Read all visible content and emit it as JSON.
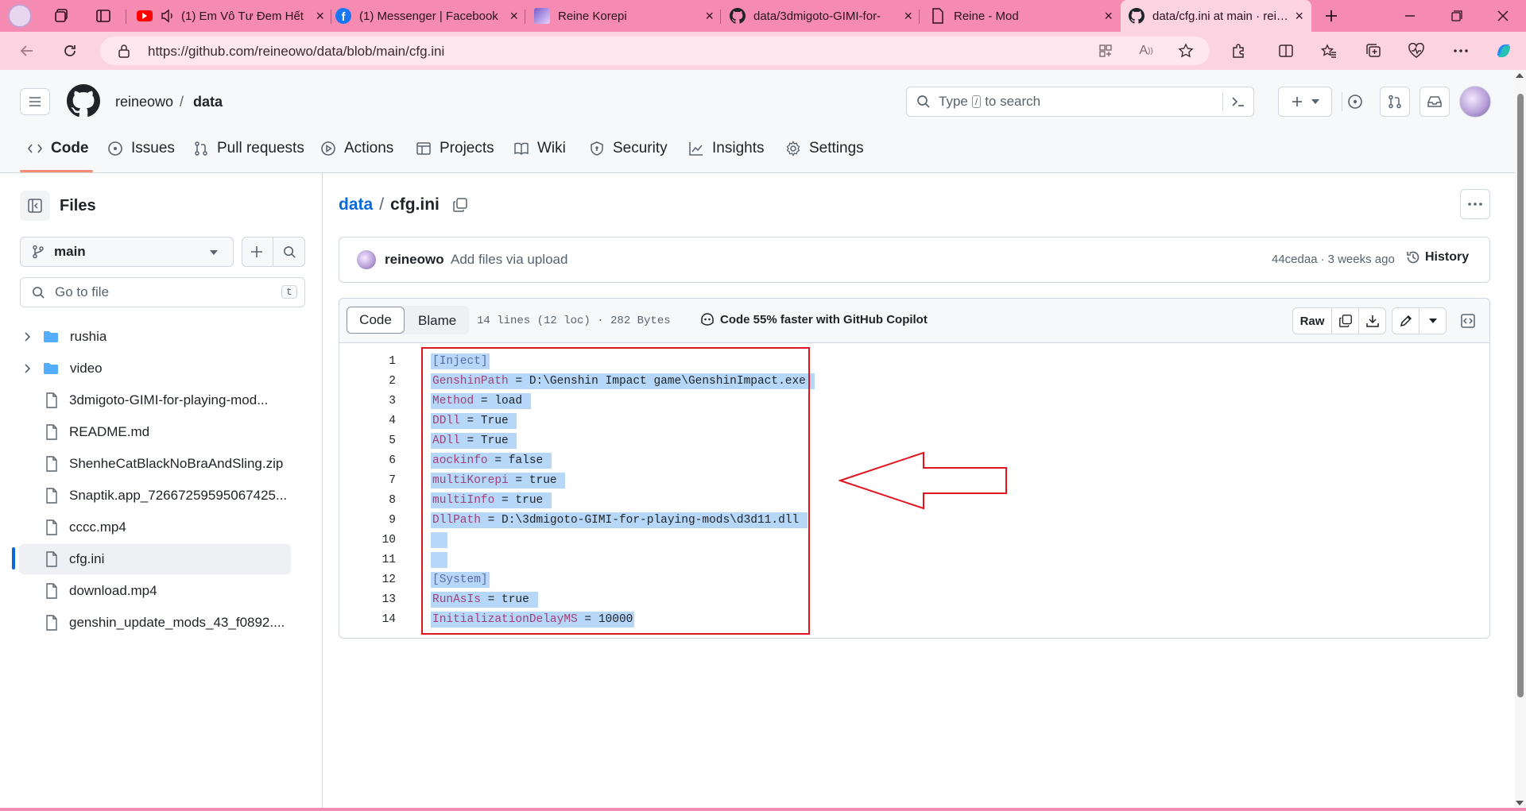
{
  "browser": {
    "tabs": [
      {
        "title": "(1) Em Vô Tư Đem Hết",
        "favicon": "youtube-icon",
        "muted": true
      },
      {
        "title": "(1) Messenger | Facebook",
        "favicon": "facebook-icon"
      },
      {
        "title": "Reine Korepi",
        "favicon": "anime-avatar-icon"
      },
      {
        "title": "data/3dmigoto-GIMI-for-",
        "favicon": "github-icon"
      },
      {
        "title": "Reine - Mod",
        "favicon": "document-icon"
      },
      {
        "title": "data/cfg.ini at main · reine",
        "favicon": "github-icon",
        "active": true
      }
    ],
    "url": "https://github.com/reineowo/data/blob/main/cfg.ini"
  },
  "header": {
    "owner": "reineowo",
    "separator": "/",
    "repo": "data",
    "search_placeholder_prefix": "Type",
    "search_key": "/",
    "search_placeholder_suffix": "to search"
  },
  "repo_tabs": [
    "Code",
    "Issues",
    "Pull requests",
    "Actions",
    "Projects",
    "Wiki",
    "Security",
    "Insights",
    "Settings"
  ],
  "sidebar": {
    "title": "Files",
    "branch": "main",
    "goto_placeholder": "Go to file",
    "goto_shortcut": "t",
    "items": [
      {
        "name": "rushia",
        "type": "folder"
      },
      {
        "name": "video",
        "type": "folder"
      },
      {
        "name": "3dmigoto-GIMI-for-playing-mod...",
        "type": "file"
      },
      {
        "name": "README.md",
        "type": "file"
      },
      {
        "name": "ShenheCatBlackNoBraAndSling.zip",
        "type": "file"
      },
      {
        "name": "Snaptik.app_72667259595067425...",
        "type": "file"
      },
      {
        "name": "cccc.mp4",
        "type": "file"
      },
      {
        "name": "cfg.ini",
        "type": "file",
        "selected": true
      },
      {
        "name": "download.mp4",
        "type": "file"
      },
      {
        "name": "genshin_update_mods_43_f0892....",
        "type": "file"
      }
    ]
  },
  "file": {
    "repo_link": "data",
    "separator": "/",
    "filename": "cfg.ini",
    "commit": {
      "author": "reineowo",
      "message": "Add files via upload",
      "sha": "44cedaa",
      "dot": "·",
      "age": "3 weeks ago",
      "history_label": "History"
    },
    "toolbar": {
      "code_tab": "Code",
      "blame_tab": "Blame",
      "stats": "14 lines (12 loc) · 282 Bytes",
      "copilot": "Code 55% faster with GitHub Copilot",
      "raw_label": "Raw"
    },
    "lines": [
      {
        "n": "1",
        "key": "[Inject]",
        "type": "section"
      },
      {
        "n": "2",
        "key": "GenshinPath",
        "val": " = D:\\Genshin Impact game\\GenshinImpact.exe "
      },
      {
        "n": "3",
        "key": "Method",
        "val": " = load "
      },
      {
        "n": "4",
        "key": "DDll",
        "val": " = True "
      },
      {
        "n": "5",
        "key": "ADll",
        "val": " = True "
      },
      {
        "n": "6",
        "key": "aockinfo",
        "val": " = false "
      },
      {
        "n": "7",
        "key": "multiKorepi",
        "val": " = true "
      },
      {
        "n": "8",
        "key": "multiInfo",
        "val": " = true "
      },
      {
        "n": "9",
        "key": "DllPath",
        "val": " = D:\\3dmigoto-GIMI-for-playing-mods\\d3d11.dll "
      },
      {
        "n": "10",
        "key": "",
        "val": "  ",
        "type": "blank"
      },
      {
        "n": "11",
        "key": "",
        "val": "  ",
        "type": "blank"
      },
      {
        "n": "12",
        "key": "[System]",
        "type": "section"
      },
      {
        "n": "13",
        "key": "RunAsIs",
        "val": " = true "
      },
      {
        "n": "14",
        "key": "InitializationDelayMS",
        "val": " = 10000"
      }
    ]
  },
  "colors": {
    "browser_accent": "#f58bb0",
    "annotation_red": "#e0141e",
    "selection": "#b6d7f7",
    "link_blue": "#0969da",
    "tab_underline": "#fd8c73"
  }
}
